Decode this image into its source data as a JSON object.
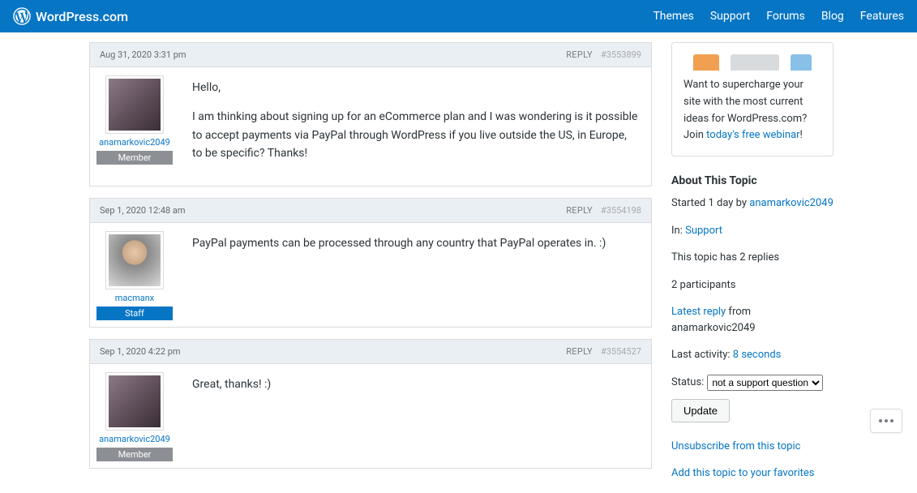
{
  "header": {
    "brand": "WordPress.com",
    "nav": [
      "Themes",
      "Support",
      "Forums",
      "Blog",
      "Features"
    ]
  },
  "posts": [
    {
      "date": "Aug 31, 2020 3:31 pm",
      "reply": "REPLY",
      "id": "#3553899",
      "author": "anamarkovic2049",
      "badge": "Member",
      "badgeClass": "badge-member",
      "avatarColor": "#6b5b73",
      "paragraphs": [
        "Hello,",
        "I am thinking about signing up for an eCommerce plan and I was wondering is it possible to accept payments via PayPal through WordPress if you live outside the US, in Europe, to be specific? Thanks!"
      ]
    },
    {
      "date": "Sep 1, 2020 12:48 am",
      "reply": "REPLY",
      "id": "#3554198",
      "author": "macmanx",
      "badge": "Staff",
      "badgeClass": "badge-staff",
      "avatarColor": "#b89878",
      "paragraphs": [
        "PayPal payments can be processed through any country that PayPal operates in. :)"
      ]
    },
    {
      "date": "Sep 1, 2020 4:22 pm",
      "reply": "REPLY",
      "id": "#3554527",
      "author": "anamarkovic2049",
      "badge": "Member",
      "badgeClass": "badge-member",
      "avatarColor": "#6b5b73",
      "paragraphs": [
        "Great, thanks! :)"
      ]
    }
  ],
  "promo": {
    "text_prefix": "Want to supercharge your site with the most current ideas for WordPress.com? Join ",
    "link": "today's free webinar",
    "suffix": "!"
  },
  "about": {
    "heading": "About This Topic",
    "started_prefix": "Started 1 day by ",
    "started_author": "anamarkovic2049",
    "in_label": "In: ",
    "in_link": "Support",
    "replies": "This topic has 2 replies",
    "participants": "2 participants",
    "latest_link": "Latest reply",
    "latest_suffix": " from anamarkovic2049",
    "activity_label": "Last activity: ",
    "activity_link": "8 seconds",
    "status_label": "Status:",
    "status_value": "not a support question",
    "update": "Update",
    "unsubscribe": "Unsubscribe from this topic",
    "favorites": "Add this topic to your favorites"
  }
}
